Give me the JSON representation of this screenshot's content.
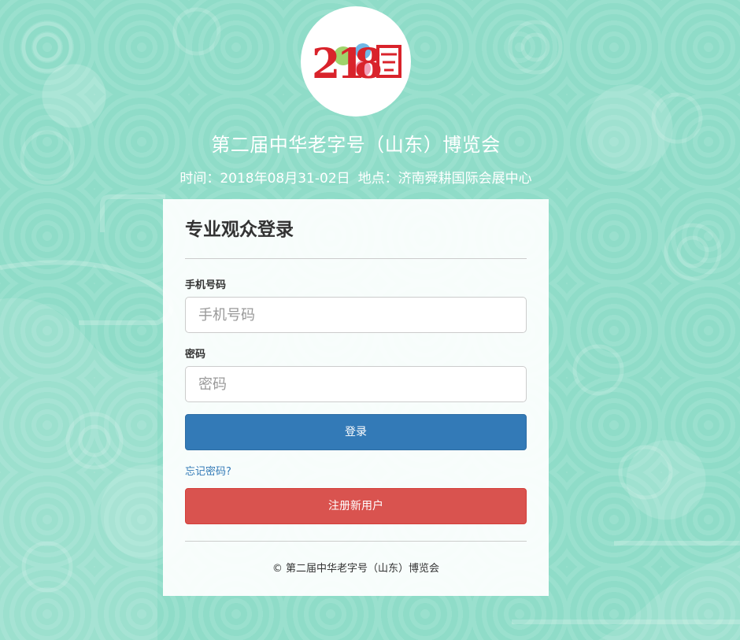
{
  "header": {
    "logo_text": "2018阁",
    "title": "第二届中华老字号（山东）博览会",
    "time_label": "时间：2018年08月31-02日",
    "place_label": "地点：济南舜耕国际会展中心"
  },
  "login": {
    "heading": "专业观众登录",
    "phone_label": "手机号码",
    "phone_placeholder": "手机号码",
    "password_label": "密码",
    "password_placeholder": "密码",
    "login_button": "登录",
    "forgot_link": "忘记密码?",
    "register_button": "注册新用户",
    "footer": "© 第二届中华老字号（山东）博览会"
  },
  "colors": {
    "background": "#8fdcc8",
    "primary": "#337ab7",
    "danger": "#d9534f"
  }
}
